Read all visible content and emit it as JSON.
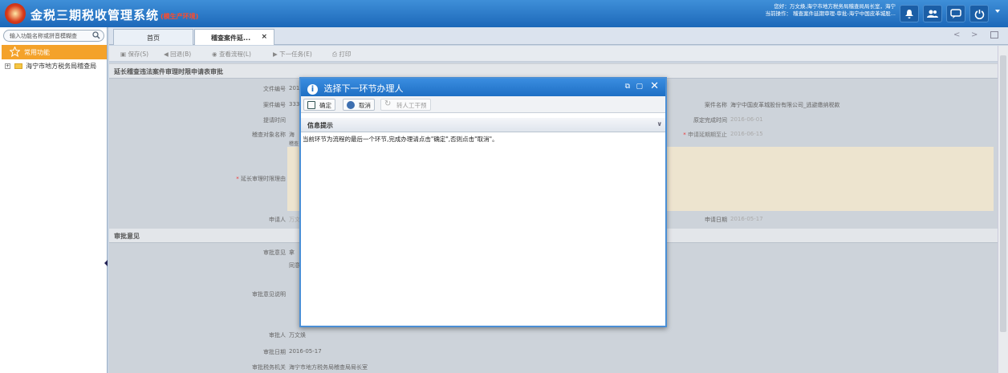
{
  "header": {
    "title": "金税三期税收管理系统",
    "env": "(模生产环境)",
    "user_line1": "您好：万文焕,海宁市地方税务局稽查局局长室，海宁",
    "user_line2": "当前操作： 稽查案件延期审理-审批-海宁中国皮革城股..."
  },
  "sidebar": {
    "search_placeholder": "输入功能名称或拼音模糊查",
    "fav_label": "常用功能",
    "tree_item": "海宁市地方税务局稽查局"
  },
  "tabs": [
    {
      "label": "首页"
    },
    {
      "label": "稽查案件延..."
    }
  ],
  "tab_close": "×",
  "nav": {
    "prev": "<",
    "next": ">"
  },
  "toolbar": {
    "save": "保存(S)",
    "back": "回退(B)",
    "view_flow": "查看流程(L)",
    "next_task": "下一任务(E)",
    "print": "打印"
  },
  "form": {
    "section1": "延长稽查违法案件审理时限申请表审批",
    "doc_no_label": "文件编号",
    "doc_no_val": "201",
    "case_no_label": "案件编号",
    "case_no_val": "333",
    "case_name_label": "案件名称",
    "case_name_val": "海宁中国皮革城股份有限公司_逃避缴纳税款",
    "submit_time_label": "提请时间",
    "orig_deadline_label": "原定完成时间",
    "orig_deadline_val": "2016-06-01",
    "target_label": "稽查对象名称",
    "target_val": "海",
    "extend_to_label": "申请延期期至止",
    "extend_to_val": "2016-06-15",
    "note_text": "稽查",
    "reason_label": "延长审理时限理由",
    "applicant_label": "申请人",
    "applicant_val": "万文",
    "apply_date_label": "申请日期",
    "apply_date_val": "2016-05-17",
    "section2": "审批意见",
    "opinion_label": "审批意见",
    "opinion_val": "拿",
    "opinion_desc_label": "审批意见说明",
    "opinion_desc_val": "同意",
    "approver_label": "审批人",
    "approver_val": "万文焕",
    "approve_date_label": "审批日期",
    "approve_date_val": "2016-05-17",
    "org_label": "审批税务机关",
    "org_val": "海宁市地方税务局稽查局局长室"
  },
  "modal": {
    "title": "选择下一环节办理人",
    "ok": "确定",
    "cancel": "取消",
    "transfer": "转人工干预",
    "info_title": "信息提示",
    "message": "当前环节为流程的最后一个环节,完成办理请点击\"确定\",否则点击\"取消\"。"
  }
}
